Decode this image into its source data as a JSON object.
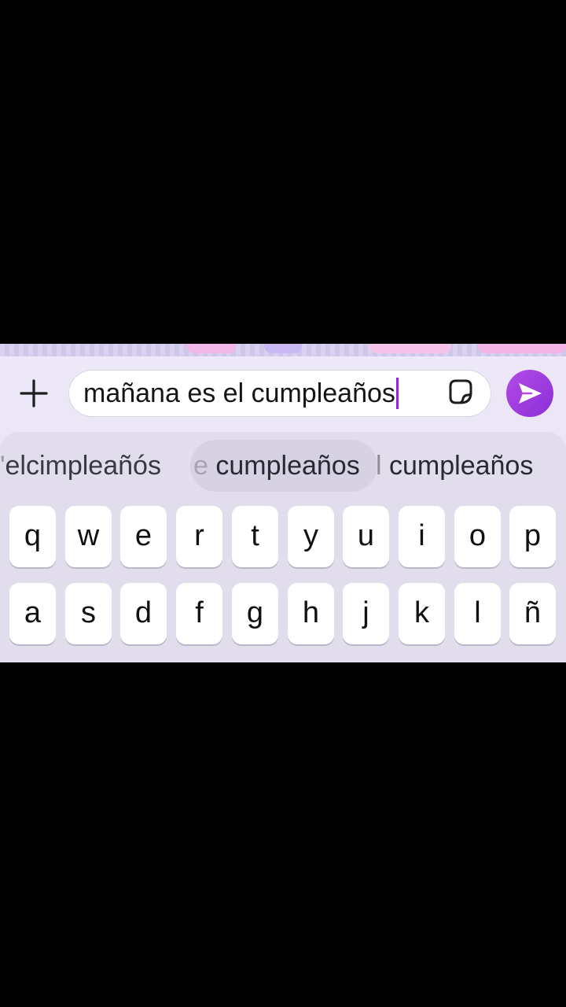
{
  "composer": {
    "message_text": "mañana es el cumpleaños"
  },
  "suggestions": [
    {
      "prefix": "'",
      "main": "elcimpleañós",
      "suffix": ""
    },
    {
      "prefix": "e",
      "main": " cumpleaños",
      "suffix": ""
    },
    {
      "prefix": "l",
      "main": " cumpleaños",
      "suffix": ""
    }
  ],
  "keyboard": {
    "row1": [
      "q",
      "w",
      "e",
      "r",
      "t",
      "y",
      "u",
      "i",
      "o",
      "p"
    ],
    "row2": [
      "a",
      "s",
      "d",
      "f",
      "g",
      "h",
      "j",
      "k",
      "l",
      "ñ"
    ]
  },
  "icons": {
    "add": "plus-icon",
    "sticker": "sticker-icon",
    "send": "send-icon"
  },
  "colors": {
    "accent": "#9a3be0",
    "caret": "#8c2bd8",
    "background": "#ece8f7"
  }
}
